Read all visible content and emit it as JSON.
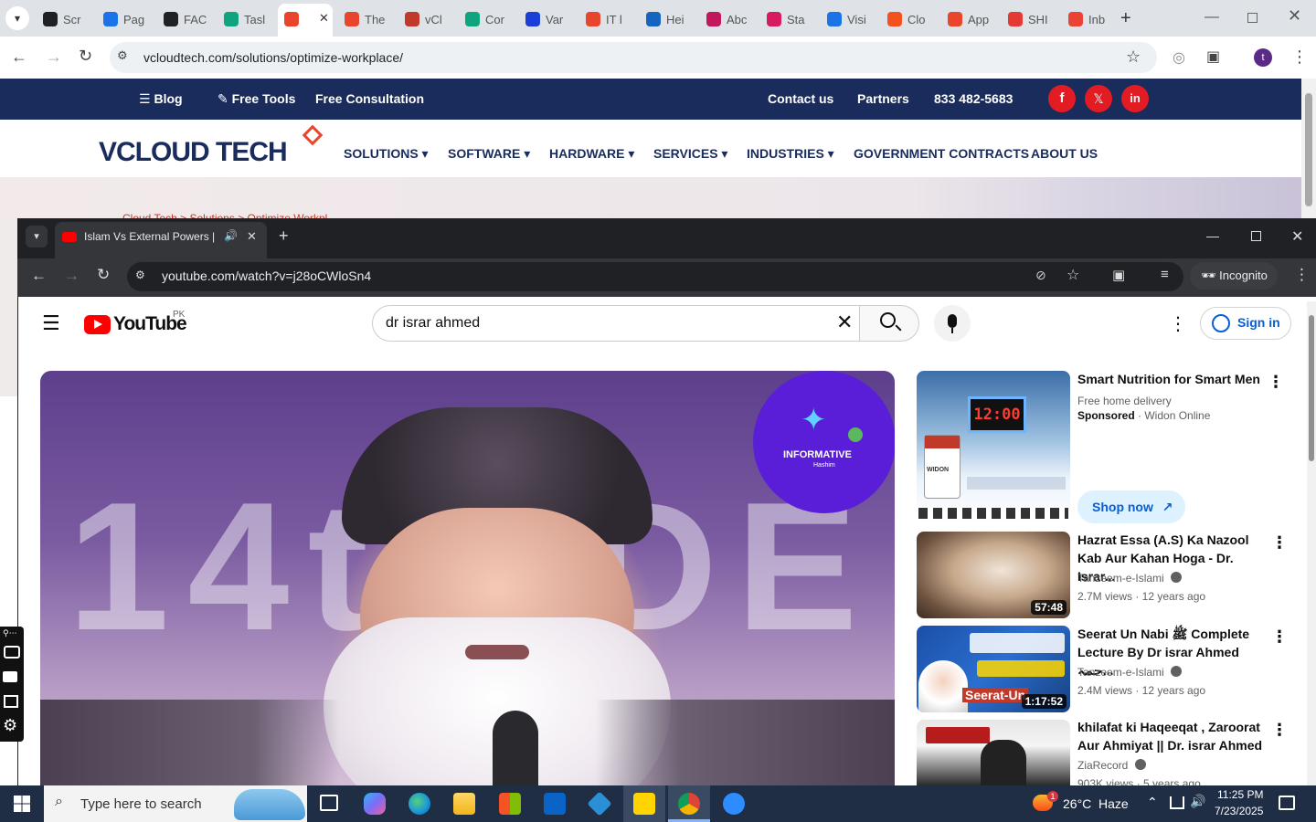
{
  "bg_browser": {
    "tabs": [
      {
        "label": "Scr",
        "color": "#202124"
      },
      {
        "label": "Pag",
        "color": "#1a73e8"
      },
      {
        "label": "FAC",
        "color": "#202124"
      },
      {
        "label": "Tasl",
        "color": "#10a37f"
      },
      {
        "label": "",
        "color": "#e8452c"
      },
      {
        "label": "The",
        "color": "#e8452c"
      },
      {
        "label": "vCl",
        "color": "#c0392b"
      },
      {
        "label": "Cor",
        "color": "#10a37f"
      },
      {
        "label": "Var",
        "color": "#1a3fd8"
      },
      {
        "label": "IT l",
        "color": "#e8452c"
      },
      {
        "label": "Hei",
        "color": "#1565c0"
      },
      {
        "label": "Abc",
        "color": "#c2185b"
      },
      {
        "label": "Sta",
        "color": "#d81b60"
      },
      {
        "label": "Visi",
        "color": "#1a73e8"
      },
      {
        "label": "Clo",
        "color": "#f4511e"
      },
      {
        "label": "App",
        "color": "#e8452c"
      },
      {
        "label": "SHI",
        "color": "#e53935"
      },
      {
        "label": "Inb",
        "color": "#ea4335"
      }
    ],
    "url": "vcloudtech.com/solutions/optimize-workplace/",
    "profile_initial": "t"
  },
  "site": {
    "topbar": {
      "blog": "Blog",
      "free_tools": "Free Tools",
      "free_consultation": "Free Consultation",
      "contact": "Contact us",
      "partners": "Partners",
      "phone": "833 482-5683"
    },
    "logo_text": "VCLOUD TECH",
    "nav": [
      "SOLUTIONS",
      "SOFTWARE",
      "HARDWARE",
      "SERVICES",
      "INDUSTRIES",
      "GOVERNMENT CONTRACTS",
      "ABOUT US"
    ],
    "breadcrumb_partial": "Cloud Tech > Solutions > Optimize Workpl..."
  },
  "incognito": {
    "tab_title": "Islam Vs External Powers | F",
    "url": "youtube.com/watch?v=j28oCWloSn4",
    "incognito_label": "Incognito"
  },
  "youtube": {
    "logo_text": "YouTube",
    "region": "PK",
    "search_value": "dr israr ahmed",
    "sign_in": "Sign in",
    "player_watermark": "INFORMATIVE",
    "player_watermark_sub": "Hashim",
    "player_bg_text": "14th DE",
    "ad": {
      "title": "Smart Nutrition for Smart Men",
      "desc": "Free home delivery",
      "sponsored": "Sponsored",
      "advertiser": "Widon Online",
      "cta": "Shop now",
      "thumb_clock": "12:00",
      "thumb_brand": "WIDON"
    },
    "recommendations": [
      {
        "title": "Hazrat Essa (A.S) Ka Nazool Kab Aur Kahan Hoga - Dr. Israr...",
        "channel": "Tanzeem-e-Islami",
        "meta": "2.7M views · 12 years ago",
        "duration": "57:48"
      },
      {
        "title": "Seerat Un Nabi ﷺ Complete Lecture By Dr israr Ahmed حمہ...",
        "channel": "Tanzeem-e-Islami",
        "meta": "2.4M views · 12 years ago",
        "duration": "1:17:52",
        "thumb_text": "Seerat-Un"
      },
      {
        "title": "khilafat ki Haqeeqat , Zaroorat Aur Ahmiyat || Dr. israr Ahmed",
        "channel": "ZiaRecord",
        "meta": "903K views · 5 years ago",
        "duration": ""
      }
    ]
  },
  "taskbar": {
    "search_placeholder": "Type here to search",
    "weather_temp": "26°C",
    "weather_desc": "Haze",
    "weather_badge": "1",
    "time": "11:25 PM",
    "date": "7/23/2025"
  }
}
